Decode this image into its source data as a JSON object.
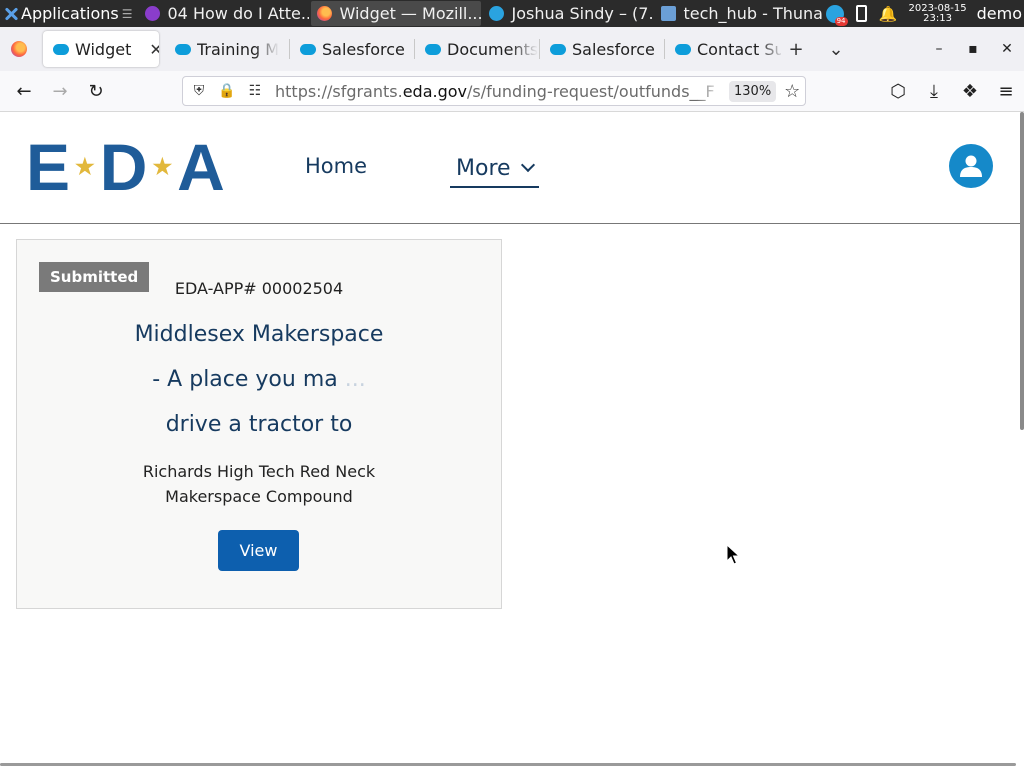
{
  "taskbar": {
    "apps_label": "Applications",
    "apps_sep": "☰",
    "windows": [
      {
        "label": "04 How do I Atte...",
        "icon_color": "#8a3dcb"
      },
      {
        "label": "Widget — Mozill...",
        "icon_color": "#ff7139"
      },
      {
        "label": "Joshua Sindy – (7...",
        "icon_color": "#2aa3e0"
      },
      {
        "label": "tech_hub - Thunar",
        "icon_color": "#6b9fd6"
      }
    ],
    "tray_badge": "94",
    "clock_date": "2023-08-15",
    "clock_time": "23:13",
    "user": "demo"
  },
  "browser": {
    "tabs": [
      {
        "label": "Widget",
        "active": true
      },
      {
        "label": "Training M",
        "active": false
      },
      {
        "label": "Salesforce",
        "active": false
      },
      {
        "label": "Documents",
        "active": false
      },
      {
        "label": "Salesforce",
        "active": false
      },
      {
        "label": "Contact Su",
        "active": false
      }
    ],
    "new_tab": "+",
    "list_tabs": "⌄",
    "url_prefix": "https://sfgrants.",
    "url_host": "eda.gov",
    "url_path": "/s/funding-request/outfunds__F",
    "zoom": "130%"
  },
  "site": {
    "logo_left": "E",
    "logo_mid": "D",
    "logo_right": "A",
    "logo_dot": "★",
    "nav_home": "Home",
    "nav_more": "More"
  },
  "card": {
    "status": "Submitted",
    "app_number": "EDA-APP# 00002504",
    "title_line1": "Middlesex Makerspace",
    "title_line2": "- A place you ma",
    "title_line2_fade": "...",
    "title_line3": "drive a tractor to",
    "org_line1": "Richards High Tech Red Neck",
    "org_line2": "Makerspace Compound",
    "view_label": "View"
  },
  "colors": {
    "brand_navy": "#163a5f",
    "logo_blue": "#1f5c99",
    "logo_gold": "#e2b83c",
    "button_blue": "#0d5fae",
    "badge_gray": "#7a7a7a",
    "avatar_blue": "#1589c9"
  }
}
